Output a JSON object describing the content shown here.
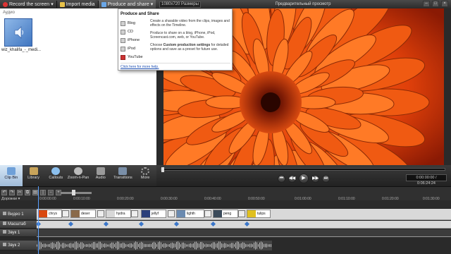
{
  "toolbar": {
    "record_label": "Record the screen",
    "import_label": "Import media",
    "produce_label": "Produce and share",
    "size_label": "1080x720 Размеры",
    "preview_title": "Предварительный просмотр"
  },
  "clipbin": {
    "section_label": "Аудио",
    "clip_name": "wiz_khalifa_-_medi..."
  },
  "tooltip": {
    "title": "Produce and Share",
    "items": [
      "Blog",
      "CD",
      "iPhone",
      "iPod",
      "YouTube"
    ],
    "p1": "Create a sharable video from the clips, images and effects on the Timeline.",
    "p2": "Produce to share on a blog, iPhone, iPod, Screencast.com, web, or YouTube.",
    "p3_strong": "Custom production settings",
    "p3_pre": "Choose ",
    "p3_post": " for detailed options and save as a preset for future use.",
    "link": "Click here for more help."
  },
  "playback": {
    "timecode": "0:00:00:00 / 0:06:24:24"
  },
  "tasks": [
    {
      "label": "Clip Bin"
    },
    {
      "label": "Library"
    },
    {
      "label": "Callouts"
    },
    {
      "label": "Zoom-n-Pan"
    },
    {
      "label": "Audio"
    },
    {
      "label": "Transitions"
    },
    {
      "label": "More"
    }
  ],
  "timeline": {
    "tracks_label": "Дорожки",
    "ruler": [
      "0:00:00:00",
      "0:00:10:00",
      "0:00:20:00",
      "0:00:30:00",
      "0:00:40:00",
      "0:00:50:00",
      "0:01:00:00",
      "0:01:10:00",
      "0:01:20:00",
      "0:01:30:00"
    ],
    "track_names": [
      "Видео 1",
      "Масштаб",
      "Звук 1",
      "Звук 2"
    ],
    "clips": [
      "chrys",
      "deser",
      "hydra",
      "jellyf",
      "lighth",
      "peng",
      "tulips"
    ]
  },
  "colors": {
    "accent": "#5aa0ff",
    "toolbar_bg": "#2b2b2b",
    "youtube": "#cc3333"
  }
}
